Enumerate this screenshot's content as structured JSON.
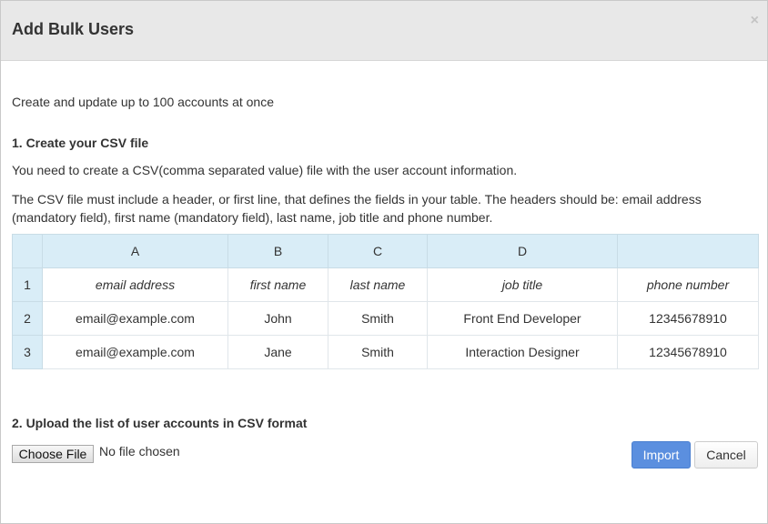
{
  "header": {
    "title": "Add Bulk Users",
    "close_label": "×"
  },
  "intro": "Create and update up to 100 accounts at once",
  "step1": {
    "title": "1. Create your CSV file",
    "para1": "You need to create a CSV(comma separated value) file with the user account information.",
    "para2": "The CSV file must include a header, or first line, that defines the fields in your table. The headers should be: email address (mandatory field), first name (mandatory field), last name, job title and phone number."
  },
  "table": {
    "columns": [
      "A",
      "B",
      "C",
      "D",
      ""
    ],
    "rows": [
      {
        "num": "1",
        "cells": [
          "email address",
          "first name",
          "last name",
          "job title",
          "phone number"
        ]
      },
      {
        "num": "2",
        "cells": [
          "email@example.com",
          "John",
          "Smith",
          "Front End Developer",
          "12345678910"
        ]
      },
      {
        "num": "3",
        "cells": [
          "email@example.com",
          "Jane",
          "Smith",
          "Interaction Designer",
          "12345678910"
        ]
      }
    ]
  },
  "step2": {
    "title": "2. Upload the list of user accounts in CSV format",
    "choose_file_label": "Choose File",
    "no_file_text": "No file chosen"
  },
  "footer": {
    "import_label": "Import",
    "cancel_label": "Cancel"
  },
  "colors": {
    "header_bg": "#e8e8e8",
    "table_header_bg": "#d9edf7",
    "primary_button": "#5b8fdf"
  }
}
